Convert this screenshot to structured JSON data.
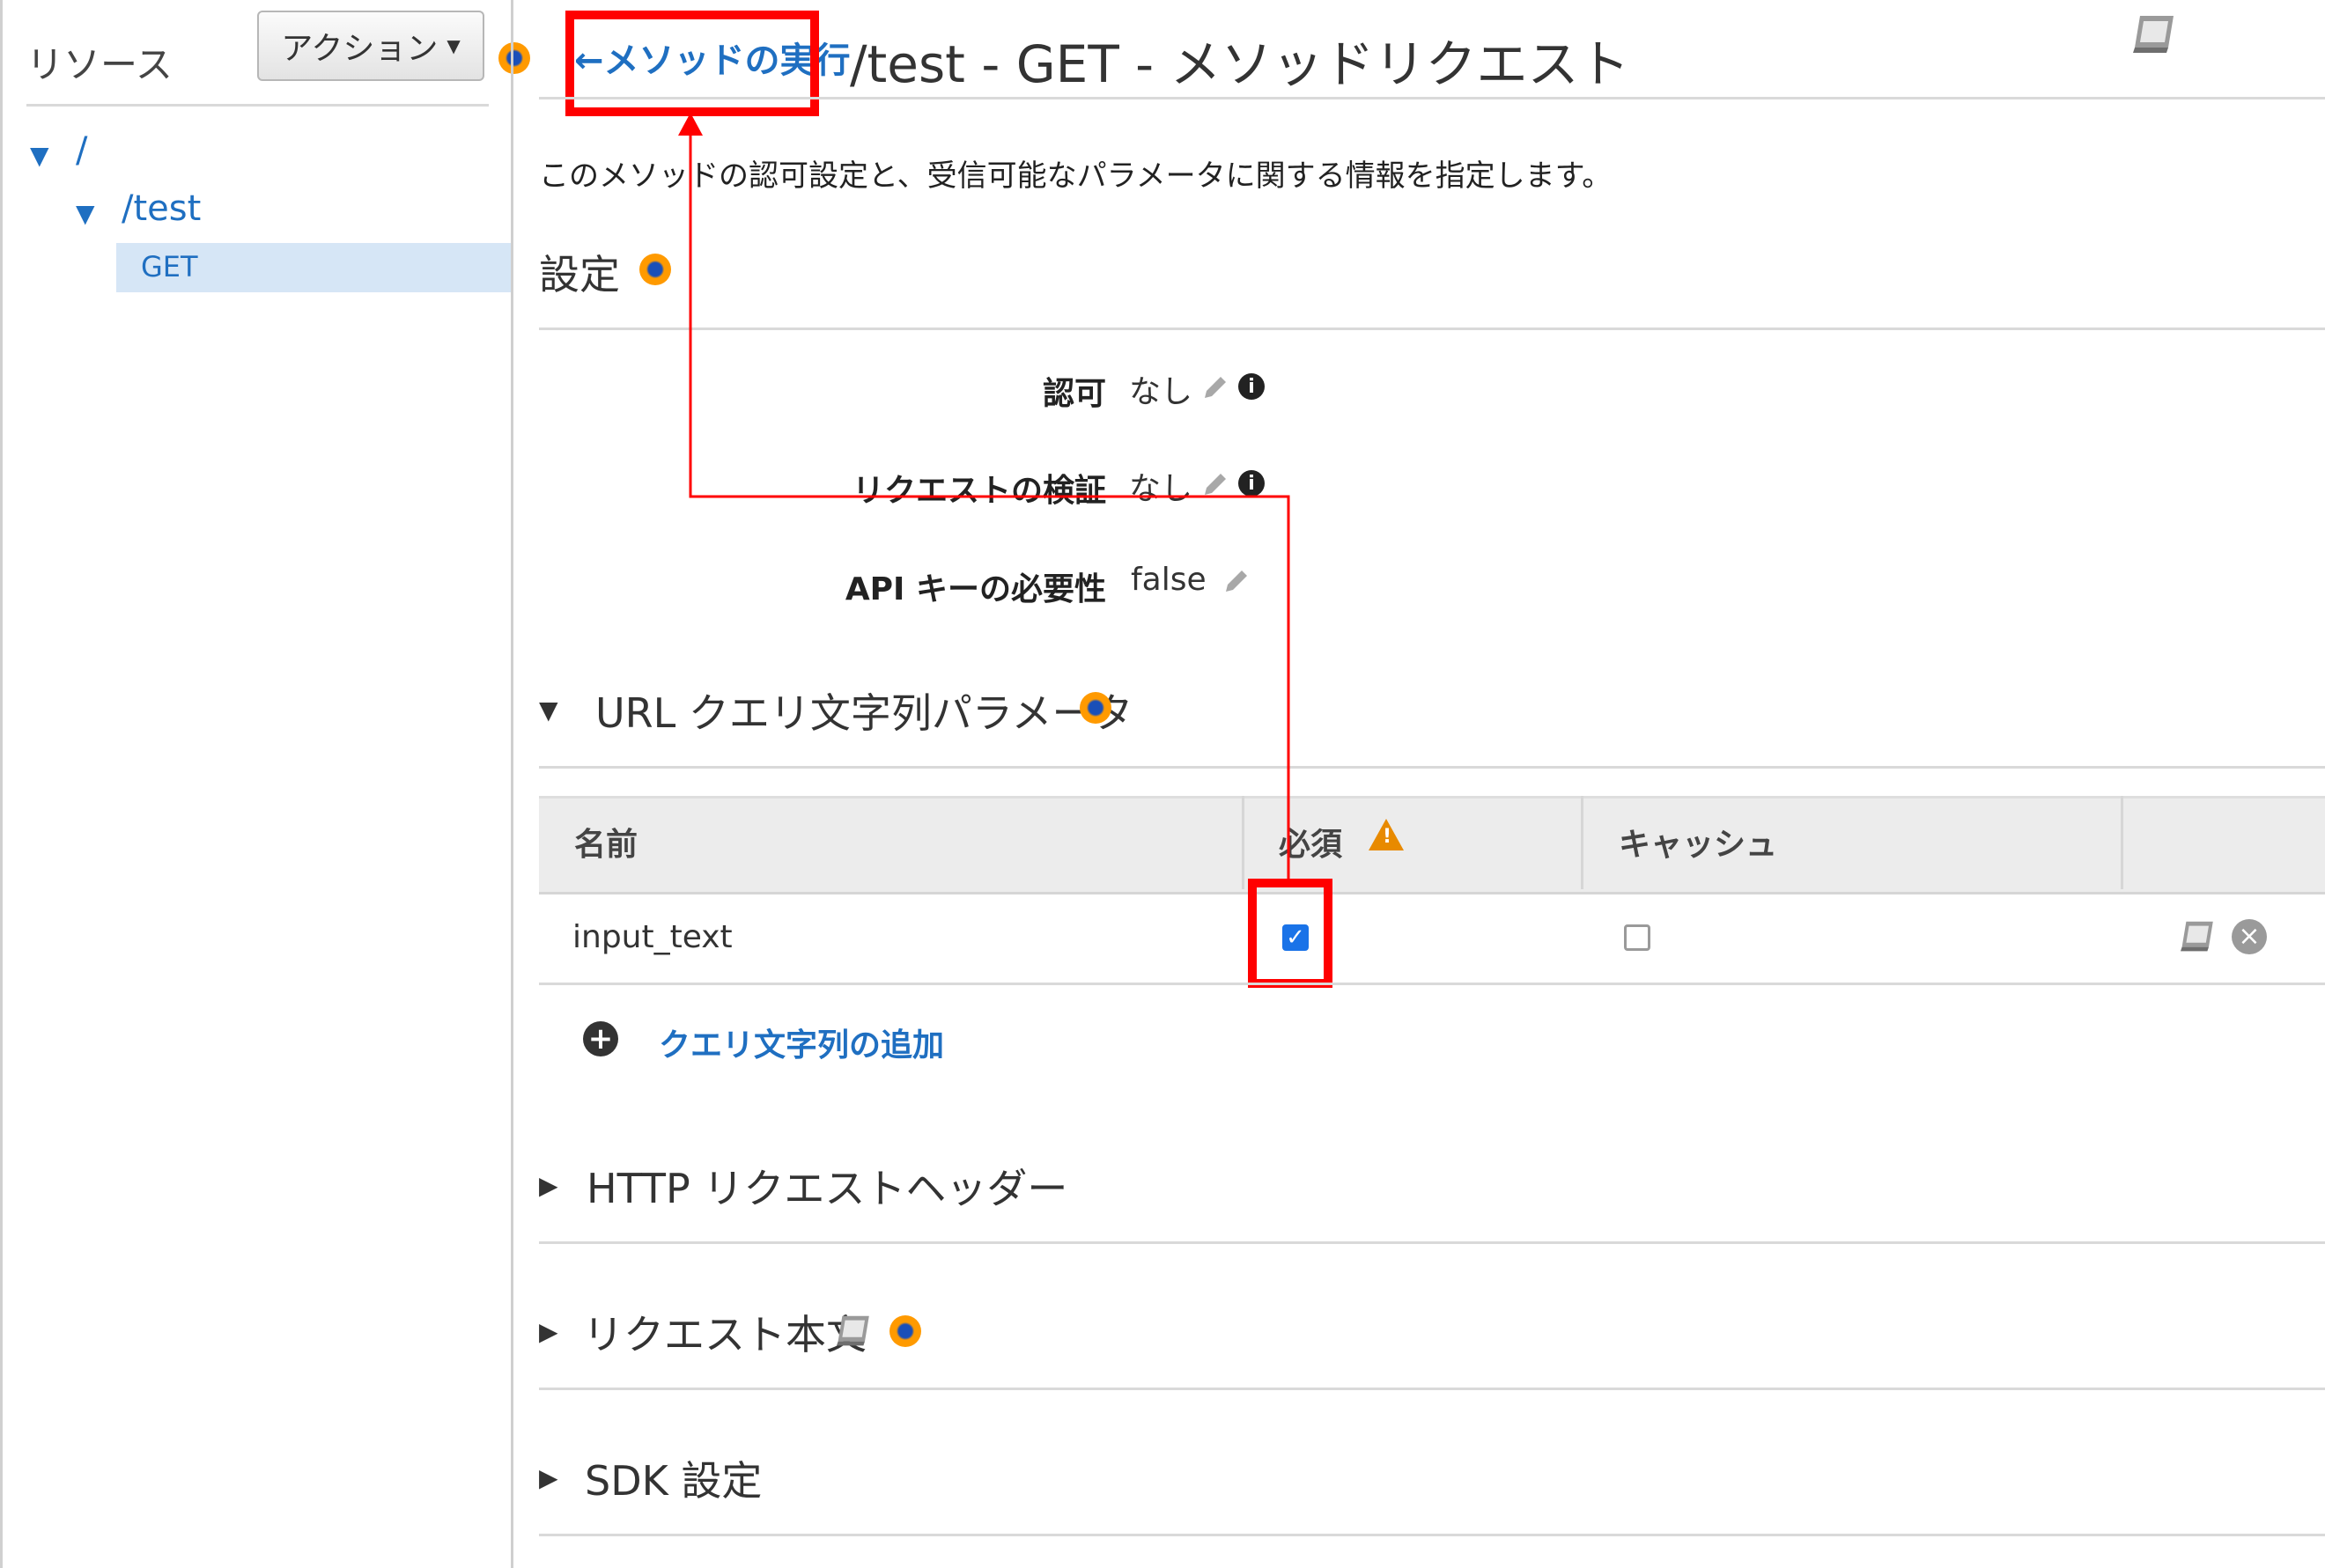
{
  "sidebar": {
    "title": "リソース",
    "actions_label": "アクション",
    "tree": [
      {
        "label": "/"
      },
      {
        "label": "/test"
      },
      {
        "label": "GET"
      }
    ]
  },
  "header": {
    "back_link": "メソッドの実行",
    "title": "/test - GET - メソッドリクエスト"
  },
  "description": "このメソッドの認可設定と、受信可能なパラメータに関する情報を指定します。",
  "settings": {
    "heading": "設定",
    "fields": [
      {
        "label": "認可",
        "value": "なし"
      },
      {
        "label": "リクエストの検証",
        "value": "なし"
      },
      {
        "label": "API キーの必要性",
        "value": "false"
      }
    ]
  },
  "query_params": {
    "heading": "URL クエリ文字列パラメータ",
    "columns": [
      "名前",
      "必須",
      "キャッシュ"
    ],
    "rows": [
      {
        "name": "input_text",
        "required": true,
        "cache": false
      }
    ],
    "add_label": "クエリ文字列の追加"
  },
  "sections": {
    "http_headers": "HTTP リクエストヘッダー",
    "request_body": "リクエスト本文",
    "sdk_settings": "SDK 設定"
  },
  "icons": {
    "info_dot": "info-dot-icon",
    "book": "book-icon",
    "pencil": "pencil-icon",
    "info": "info-icon",
    "warning": "warning-icon"
  },
  "colors": {
    "link": "#1f6fc1",
    "highlight": "#ff0000",
    "selected_bg": "#d6e6f6",
    "warning": "#e88a00"
  }
}
